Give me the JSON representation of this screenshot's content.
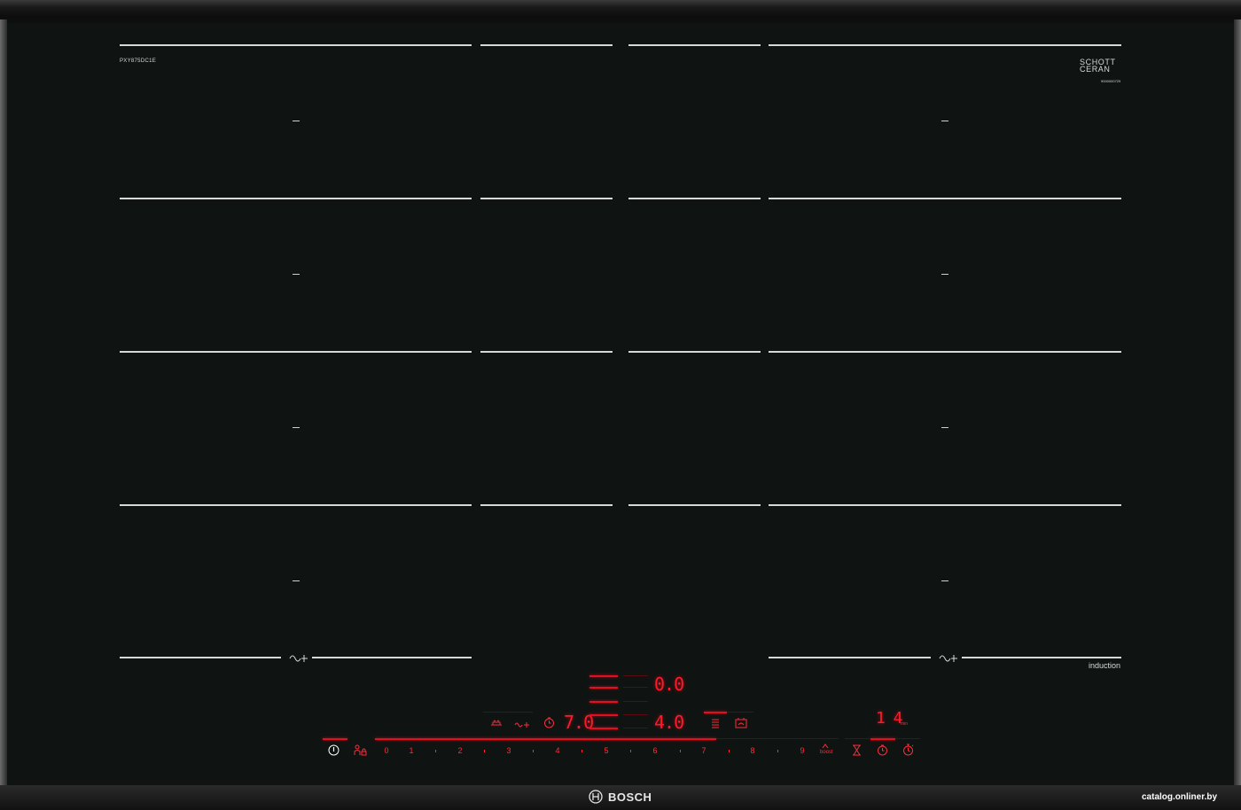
{
  "labels": {
    "model": "PXY875DC1E",
    "schott_line1": "SCHOTT",
    "schott_line2": "CERAN",
    "serial": "9000000729",
    "induction": "induction",
    "brand": "BOSCH",
    "watermark": "catalog.onliner.by"
  },
  "display": {
    "top_value": "0.0",
    "left_value": "7.0",
    "center_value": "4.0",
    "timer_value": "1 4",
    "timer_unit": "min"
  },
  "slider": {
    "levels": [
      "0",
      "1",
      "2",
      "3",
      "4",
      "5",
      "6",
      "7",
      "8",
      "9"
    ],
    "boost_label": "boost"
  },
  "icons": {
    "power": "power-icon",
    "child_lock": "child-lock-icon",
    "flex_left": "flex-zone-icon",
    "flex_right": "flex-zone-icon",
    "pan": "pan-icon",
    "flex_small": "flex-small-icon",
    "timer_small": "timer-icon",
    "menu": "menu-icon",
    "sensor": "sensor-icon",
    "hourglass": "hourglass-icon",
    "clock": "clock-icon",
    "stopwatch": "stopwatch-icon",
    "logo": "bosch-logo-icon"
  },
  "colors": {
    "glass": "#0f1412",
    "display_red": "#ff1a2a",
    "line": "#d8d8d8"
  }
}
